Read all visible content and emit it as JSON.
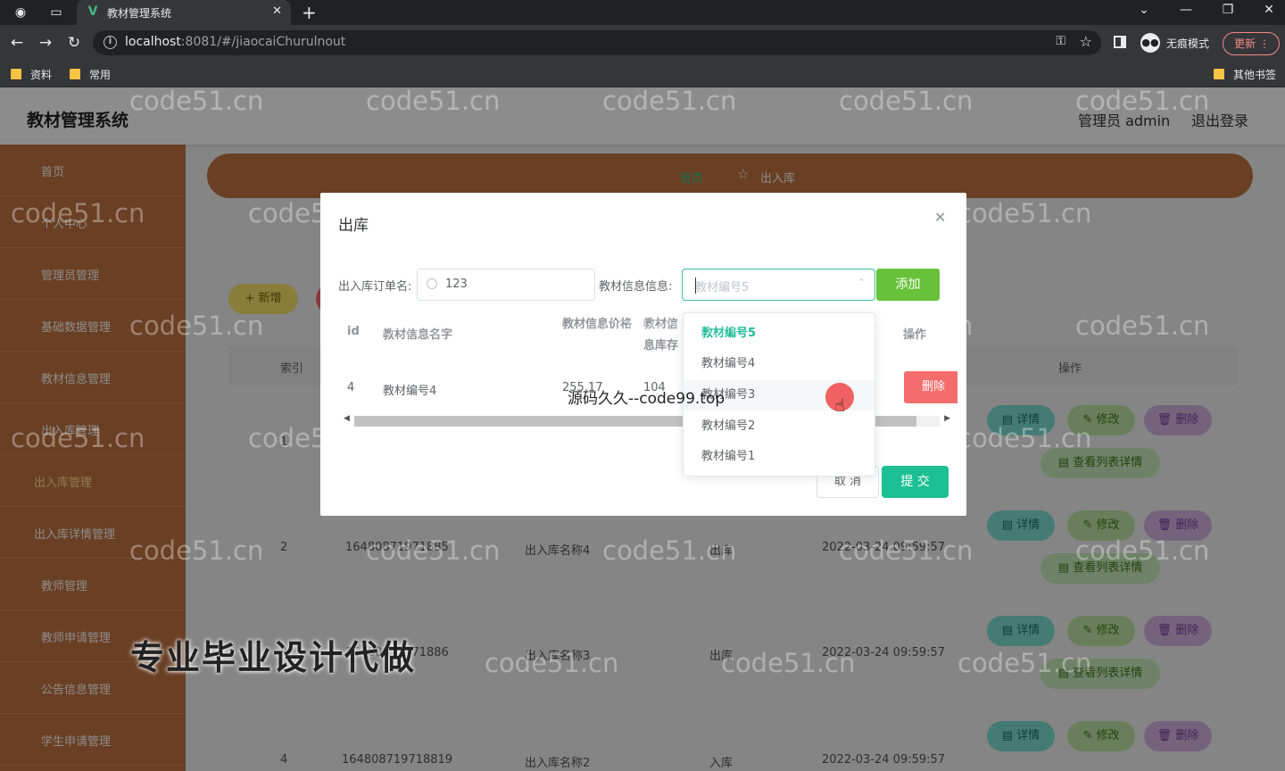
{
  "browser": {
    "tab_title": "教材管理系统",
    "url_host": "localhost",
    "url_rest": ":8081/#/jiaocaiChurulnout",
    "incognito_label": "无痕模式",
    "update_label": "更新",
    "bookmarks": [
      "资料",
      "常用"
    ],
    "other_bookmarks": "其他书签"
  },
  "header": {
    "title": "教材管理系统",
    "user": "管理员 admin",
    "logout": "退出登录"
  },
  "sidebar": {
    "items": [
      "首页",
      "个人中心",
      "管理员管理",
      "基础数据管理",
      "教材信息管理",
      "出入库管理",
      "出入库管理",
      "出入库详情管理",
      "教师管理",
      "教师申请管理",
      "公告信息管理",
      "学生申请管理"
    ]
  },
  "breadcrumb": {
    "home": "首页",
    "current": "出入库"
  },
  "toolbar": {
    "add_label": "新增"
  },
  "table": {
    "col_index": "索引",
    "col_op": "操作",
    "rows": [
      {
        "index": "1",
        "code": "",
        "name": "",
        "type": "",
        "time": ""
      },
      {
        "index": "2",
        "code": "16480871971885",
        "name": "出入库名称4",
        "type": "出库",
        "time": "2022-03-24 09:59:57"
      },
      {
        "index": "3",
        "code": "16480871971886",
        "name": "出入库名称3",
        "type": "出库",
        "time": "2022-03-24 09:59:57"
      },
      {
        "index": "4",
        "code": "164808719718819",
        "name": "出入库名称2",
        "type": "入库",
        "time": "2022-03-24 09:59:57"
      }
    ],
    "op_detail": "详情",
    "op_edit": "修改",
    "op_delete": "删除",
    "op_list": "查看列表详情"
  },
  "dialog": {
    "title": "出库",
    "order_label": "出入库订单名:",
    "order_value": "123",
    "info_label": "教材信息信息:",
    "select_placeholder": "教材编号5",
    "add_label": "添加",
    "cols": {
      "id": "id",
      "name": "教材信息名字",
      "price": "教材信息价格",
      "stock": "教材信息库存",
      "op": "操作"
    },
    "row": {
      "id": "4",
      "name": "教材编号4",
      "price": "255.17",
      "stock": "104"
    },
    "delete_label": "删除",
    "cancel_label": "取 消",
    "submit_label": "提 交"
  },
  "dropdown": {
    "options": [
      "教材编号5",
      "教材编号4",
      "教材编号3",
      "教材编号2",
      "教材编号1"
    ],
    "selected_index": 0,
    "hover_index": 2
  },
  "watermark": {
    "site": "code51.cn",
    "center": "源码久久--code99.top",
    "bottom": "专业毕业设计代做"
  }
}
